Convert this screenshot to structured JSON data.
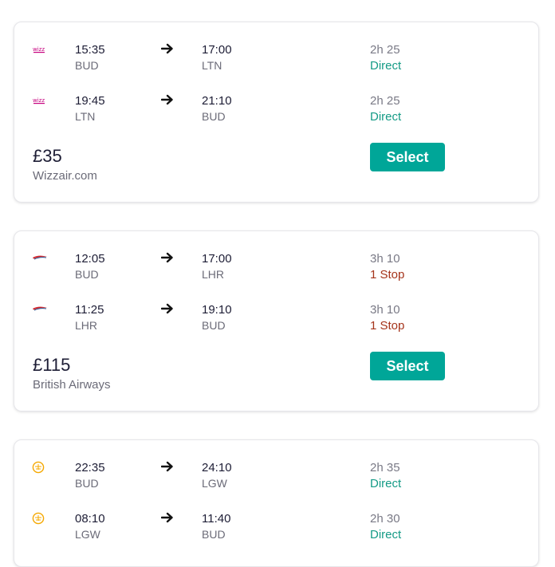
{
  "results": [
    {
      "airline_icon": "wizzair-logo-icon",
      "price": "£35",
      "provider": "Wizzair.com",
      "select_label": "Select",
      "legs": [
        {
          "dep_time": "15:35",
          "dep_code": "BUD",
          "arr_time": "17:00",
          "arr_code": "LTN",
          "duration": "2h 25",
          "stops": "Direct",
          "stops_type": "direct"
        },
        {
          "dep_time": "19:45",
          "dep_code": "LTN",
          "arr_time": "21:10",
          "arr_code": "BUD",
          "duration": "2h 25",
          "stops": "Direct",
          "stops_type": "direct"
        }
      ]
    },
    {
      "airline_icon": "british-airways-logo-icon",
      "price": "£115",
      "provider": "British Airways",
      "select_label": "Select",
      "legs": [
        {
          "dep_time": "12:05",
          "dep_code": "BUD",
          "arr_time": "17:00",
          "arr_code": "LHR",
          "duration": "3h 10",
          "stops": "1 Stop",
          "stops_type": "stop"
        },
        {
          "dep_time": "11:25",
          "dep_code": "LHR",
          "arr_time": "19:10",
          "arr_code": "BUD",
          "duration": "3h 10",
          "stops": "1 Stop",
          "stops_type": "stop"
        }
      ]
    },
    {
      "airline_icon": "lufthansa-logo-icon",
      "legs": [
        {
          "dep_time": "22:35",
          "dep_code": "BUD",
          "arr_time": "24:10",
          "arr_code": "LGW",
          "duration": "2h 35",
          "stops": "Direct",
          "stops_type": "direct"
        },
        {
          "dep_time": "08:10",
          "dep_code": "LGW",
          "arr_time": "11:40",
          "arr_code": "BUD",
          "duration": "2h 30",
          "stops": "Direct",
          "stops_type": "direct"
        }
      ]
    }
  ],
  "colors": {
    "accent": "#00a698",
    "direct": "#159b86",
    "stop": "#a5341b",
    "text_primary": "#1d1d35",
    "text_secondary": "#6b6b78"
  }
}
